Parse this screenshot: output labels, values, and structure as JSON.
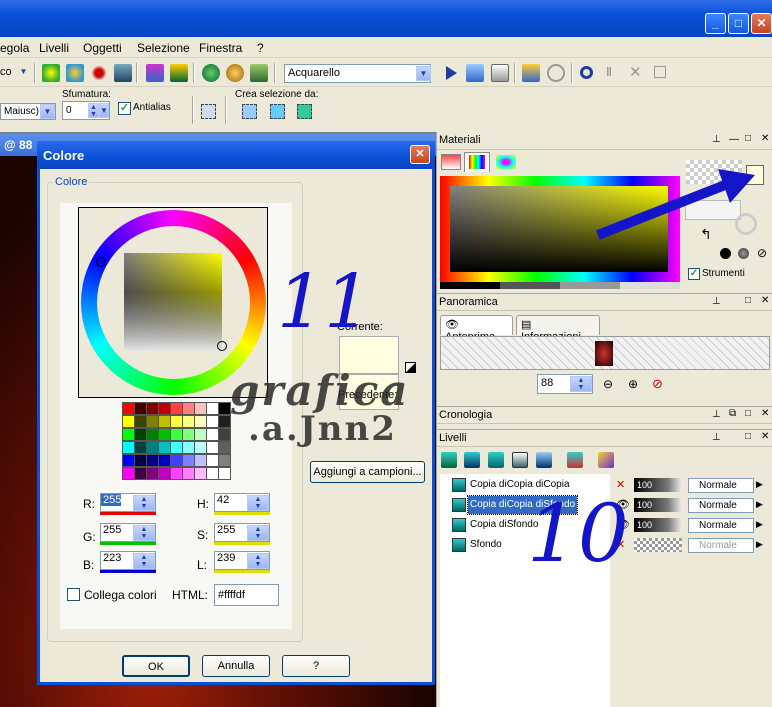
{
  "menu": {
    "items": [
      "egola",
      "Livelli",
      "Oggetti",
      "Selezione",
      "Finestra",
      "?"
    ]
  },
  "toolbar": {
    "preset_left": "co",
    "preset_value": "Acquarello"
  },
  "options": {
    "sfumatura_label": "Sfumatura:",
    "sfumatura_value": "0",
    "mode_value": "Maiusc)",
    "antialias_label": "Antialias",
    "crea_selezione_label": "Crea selezione da:"
  },
  "canvas_tab": {
    "label": "@ 88"
  },
  "dialog": {
    "title": "Colore",
    "group_label": "Colore",
    "corrente_label": "Corrente:",
    "precedente_label": "Precedente:",
    "add_swatches_label": "Aggiungi a campioni...",
    "fields": {
      "R": {
        "label": "R:",
        "value": "255",
        "bar": "#e00000"
      },
      "G": {
        "label": "G:",
        "value": "255",
        "bar": "#00c000"
      },
      "B": {
        "label": "B:",
        "value": "223",
        "bar": "#0000d0"
      },
      "H": {
        "label": "H:",
        "value": "42",
        "bar": "#e0e000"
      },
      "S": {
        "label": "S:",
        "value": "255",
        "bar": "#e0e000"
      },
      "L": {
        "label": "L:",
        "value": "239",
        "bar": "#e0e000"
      }
    },
    "link_colors_label": "Collega colori",
    "html_label": "HTML:",
    "html_value": "#ffffdf",
    "ok_label": "OK",
    "cancel_label": "Annulla",
    "help_label": "?",
    "current_color": "#ffffdf",
    "swatches": [
      [
        "#ff0000",
        "#400000",
        "#800000",
        "#c00000",
        "#ff4040",
        "#ff8080",
        "#ffc0c0",
        "#ffffff",
        "#000000"
      ],
      [
        "#ffff00",
        "#404000",
        "#808000",
        "#c0c000",
        "#ffff40",
        "#ffff80",
        "#ffffc0",
        "#ffffff",
        "#202020"
      ],
      [
        "#00ff00",
        "#004000",
        "#008000",
        "#00c000",
        "#40ff40",
        "#80ff80",
        "#c0ffc0",
        "#ffffff",
        "#404040"
      ],
      [
        "#00ffff",
        "#004040",
        "#008080",
        "#00c0c0",
        "#40ffff",
        "#80ffff",
        "#c0ffff",
        "#ffffff",
        "#606060"
      ],
      [
        "#0000ff",
        "#000040",
        "#000080",
        "#0000c0",
        "#4040ff",
        "#8080ff",
        "#c0c0ff",
        "#ffffff",
        "#808080"
      ],
      [
        "#ff00ff",
        "#400040",
        "#800080",
        "#c000c0",
        "#ff40ff",
        "#ff80ff",
        "#ffc0ff",
        "#ffffff",
        "#ffffff"
      ]
    ]
  },
  "annotations": {
    "step_11": "11",
    "step_10": "10",
    "watermark_line1": "grafica",
    "watermark_line2": ".a.Jnn2"
  },
  "materiali": {
    "title": "Materiali",
    "strumenti_label": "Strumenti"
  },
  "panoramica": {
    "title": "Panoramica",
    "tab_preview": "Anteprima",
    "tab_info": "Informazioni",
    "zoom_value": "88"
  },
  "cronologia": {
    "title": "Cronologia"
  },
  "livelli": {
    "title": "Livelli",
    "layers": [
      {
        "name": "Copia diCopia diCopia diSfondo",
        "opacity": "100",
        "blend": "Normale",
        "selected": false,
        "visible": false
      },
      {
        "name": "Copia diCopia diSfondo",
        "opacity": "100",
        "blend": "Normale",
        "selected": true,
        "visible": true
      },
      {
        "name": "Copia diSfondo",
        "opacity": "100",
        "blend": "Normale",
        "selected": false,
        "visible": true
      },
      {
        "name": "Sfondo",
        "opacity": "",
        "blend": "Normale",
        "selected": false,
        "visible": false
      }
    ]
  }
}
